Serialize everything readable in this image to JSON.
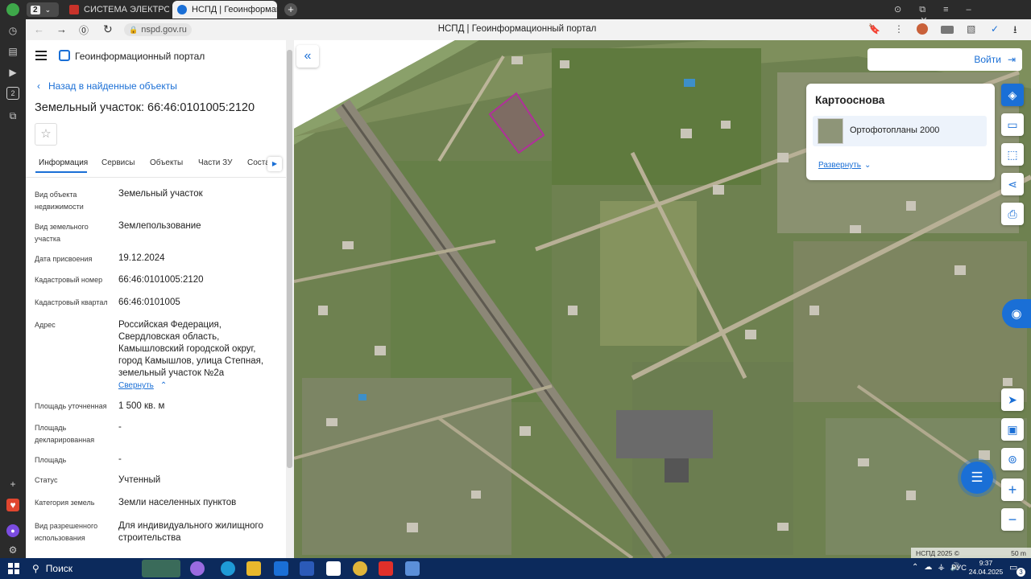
{
  "browser": {
    "tab_count": "2",
    "tabs": [
      {
        "label": "СИСТЕМА ЭЛЕКТРОННО",
        "active": false,
        "color": "#c8332a"
      },
      {
        "label": "НСПД | Геоинформац",
        "active": true,
        "color": "#1a6fd6"
      }
    ],
    "url": "nspd.gov.ru",
    "page_title": "НСПД | Геоинформационный портал"
  },
  "header": {
    "portal_name": "Геоинформационный портал"
  },
  "panel": {
    "back_link": "Назад в найденные объекты",
    "title": "Земельный участок: 66:46:0101005:2120",
    "star": "☆",
    "tabs": [
      "Информация",
      "Сервисы",
      "Объекты",
      "Части ЗУ",
      "Состав"
    ],
    "active_tab": "Информация",
    "fields": [
      {
        "label": "Вид объекта недвижимости",
        "value": "Земельный участок"
      },
      {
        "label": "Вид земельного участка",
        "value": "Землепользование"
      },
      {
        "label": "Дата присвоения",
        "value": "19.12.2024"
      },
      {
        "label": "Кадастровый номер",
        "value": "66:46:0101005:2120"
      },
      {
        "label": "Кадастровый квартал",
        "value": "66:46:0101005"
      },
      {
        "label": "Адрес",
        "value": "Российская Федерация, Свердловская область, Камышловский городской округ, город Камышлов, улица Степная, земельный участок №2а"
      },
      {
        "label": "Площадь уточненная",
        "value": "1 500 кв. м"
      },
      {
        "label": "Площадь декларированная",
        "value": "-"
      },
      {
        "label": "Площадь",
        "value": "-"
      },
      {
        "label": "Статус",
        "value": "Учтенный"
      },
      {
        "label": "Категория земель",
        "value": "Земли населенных пунктов"
      },
      {
        "label": "Вид разрешенного использования",
        "value": "Для индивидуального жилищного строительства"
      }
    ],
    "collapse_link": "Свернуть"
  },
  "map": {
    "login_label": "Войти",
    "basemap_title": "Картооснова",
    "basemap_option": "Ортофотопланы 2000",
    "expand_link": "Развернуть",
    "attribution": "НСПД 2025 ©",
    "scale": "50 m",
    "accent": "#1a6fd6",
    "parcel_color": "#b0309a"
  },
  "taskbar": {
    "search_label": "Поиск",
    "lang": "РУС",
    "time": "9:37",
    "date": "24.04.2025",
    "notif_count": "3"
  }
}
